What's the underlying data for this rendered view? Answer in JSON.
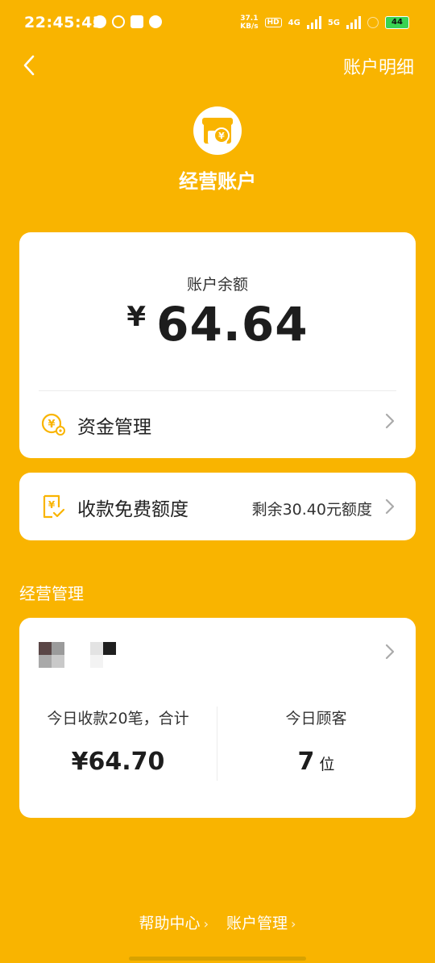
{
  "status_bar": {
    "time": "22:45:43",
    "speed_top": "37.1",
    "speed_unit": "KB/s",
    "hd": "HD",
    "net_4g": "4G",
    "net_5g": "5G",
    "battery": "44"
  },
  "header": {
    "right_link": "账户明细",
    "title": "经营账户"
  },
  "balance": {
    "label": "账户余额",
    "currency": "¥",
    "amount": "64.64"
  },
  "fund_manage": {
    "label": "资金管理"
  },
  "quota": {
    "label": "收款免费额度",
    "remaining": "剩余30.40元额度"
  },
  "business": {
    "section_title": "经营管理",
    "today_income_label": "今日收款20笔，合计",
    "today_income_value": "¥64.70",
    "today_customers_label": "今日顾客",
    "today_customers_value": "7",
    "today_customers_unit": "位"
  },
  "footer": {
    "help": "帮助中心",
    "account_manage": "账户管理"
  },
  "colors": {
    "background": "#F9B400",
    "accent": "#F9B400",
    "card": "#FFFFFF"
  }
}
